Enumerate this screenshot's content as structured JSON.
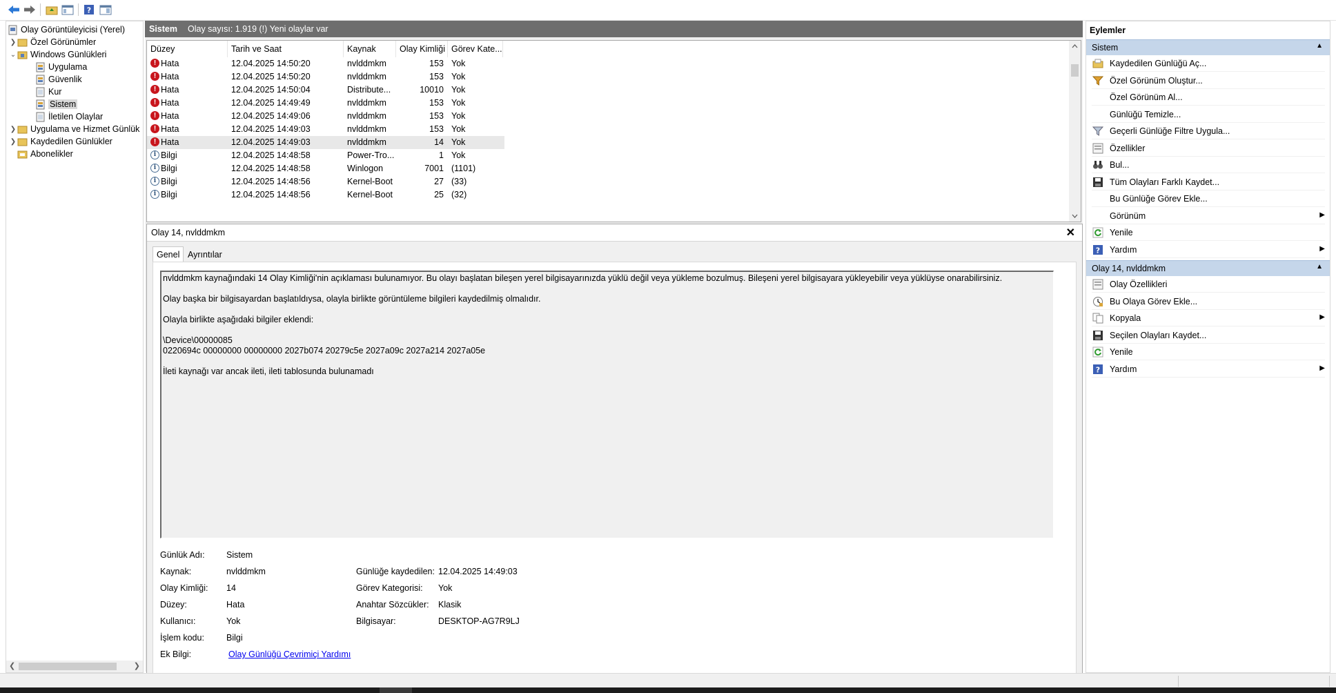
{
  "toolbar": {
    "buttons": [
      "back-icon",
      "forward-icon",
      "folder-up-icon",
      "show-hide-tree-icon",
      "help-icon",
      "action-pane-icon"
    ]
  },
  "tree": {
    "root": "Olay Görüntüleyicisi (Yerel)",
    "custom_views": "Özel Görünümler",
    "windows_logs": "Windows Günlükleri",
    "application": "Uygulama",
    "security": "Güvenlik",
    "setup": "Kur",
    "system": "Sistem",
    "forwarded": "İletilen Olaylar",
    "apps_services": "Uygulama ve Hizmet Günlük",
    "saved_logs": "Kaydedilen Günlükler",
    "subscriptions": "Abonelikler"
  },
  "log_header": {
    "name": "Sistem",
    "info": "Olay sayısı: 1.919 (!) Yeni olaylar var"
  },
  "columns": [
    "Düzey",
    "Tarih ve Saat",
    "Kaynak",
    "Olay Kimliği",
    "Görev Kate..."
  ],
  "events": [
    {
      "level": "Hata",
      "type": "error",
      "date": "12.04.2025 14:50:20",
      "source": "nvlddmkm",
      "id": "153",
      "task": "Yok"
    },
    {
      "level": "Hata",
      "type": "error",
      "date": "12.04.2025 14:50:20",
      "source": "nvlddmkm",
      "id": "153",
      "task": "Yok"
    },
    {
      "level": "Hata",
      "type": "error",
      "date": "12.04.2025 14:50:04",
      "source": "Distribute...",
      "id": "10010",
      "task": "Yok"
    },
    {
      "level": "Hata",
      "type": "error",
      "date": "12.04.2025 14:49:49",
      "source": "nvlddmkm",
      "id": "153",
      "task": "Yok"
    },
    {
      "level": "Hata",
      "type": "error",
      "date": "12.04.2025 14:49:06",
      "source": "nvlddmkm",
      "id": "153",
      "task": "Yok"
    },
    {
      "level": "Hata",
      "type": "error",
      "date": "12.04.2025 14:49:03",
      "source": "nvlddmkm",
      "id": "153",
      "task": "Yok"
    },
    {
      "level": "Hata",
      "type": "error",
      "date": "12.04.2025 14:49:03",
      "source": "nvlddmkm",
      "id": "14",
      "task": "Yok"
    },
    {
      "level": "Bilgi",
      "type": "info",
      "date": "12.04.2025 14:48:58",
      "source": "Power-Tro...",
      "id": "1",
      "task": "Yok"
    },
    {
      "level": "Bilgi",
      "type": "info",
      "date": "12.04.2025 14:48:58",
      "source": "Winlogon",
      "id": "7001",
      "task": "(1101)"
    },
    {
      "level": "Bilgi",
      "type": "info",
      "date": "12.04.2025 14:48:56",
      "source": "Kernel-Boot",
      "id": "27",
      "task": "(33)"
    },
    {
      "level": "Bilgi",
      "type": "info",
      "date": "12.04.2025 14:48:56",
      "source": "Kernel-Boot",
      "id": "25",
      "task": "(32)"
    }
  ],
  "detail": {
    "title": "Olay 14, nvlddmkm",
    "close": "✕",
    "tab_general": "Genel",
    "tab_details": "Ayrıntılar",
    "desc_lines": [
      "nvlddmkm kaynağındaki 14 Olay Kimliği'nin açıklaması bulunamıyor. Bu olayı başlatan bileşen yerel bilgisayarınızda yüklü değil veya yükleme bozulmuş. Bileşeni yerel bilgisayara yükleyebilir veya yüklüyse onarabilirsiniz.",
      "Olay başka bir bilgisayardan başlatıldıysa, olayla birlikte görüntüleme bilgileri kaydedilmiş olmalıdır.",
      "Olayla birlikte aşağıdaki bilgiler eklendi:",
      "\\Device\\00000085",
      "0220694c 00000000 00000000 2027b074 20279c5e 2027a09c 2027a214 2027a05e",
      "İleti kaynağı var ancak ileti, ileti tablosunda bulunamadı"
    ],
    "log_name_label": "Günlük Adı:",
    "log_name": "Sistem",
    "source_label": "Kaynak:",
    "source": "nvlddmkm",
    "event_id_label": "Olay Kimliği:",
    "event_id": "14",
    "level_label": "Düzey:",
    "level": "Hata",
    "user_label": "Kullanıcı:",
    "user": "Yok",
    "opcode_label": "İşlem kodu:",
    "opcode": "Bilgi",
    "more_info_label": "Ek Bilgi:",
    "more_info_link": "Olay Günlüğü Çevrimiçi Yardımı",
    "logged_label": "Günlüğe kaydedilen:",
    "logged": "12.04.2025 14:49:03",
    "task_cat_label": "Görev Kategorisi:",
    "task_cat": "Yok",
    "keywords_label": "Anahtar Sözcükler:",
    "keywords": "Klasik",
    "computer_label": "Bilgisayar:",
    "computer": "DESKTOP-AG7R9LJ"
  },
  "actions": {
    "title": "Eylemler",
    "section1": "Sistem",
    "items1": [
      {
        "label": "Kaydedilen Günlüğü Aç...",
        "icon": "open-saved-log-icon"
      },
      {
        "label": "Özel Görünüm Oluştur...",
        "icon": "filter-create-icon"
      },
      {
        "label": "Özel Görünüm Al...",
        "icon": "none"
      },
      {
        "label": "Günlüğü Temizle...",
        "icon": "none"
      },
      {
        "label": "Geçerli Günlüğe Filtre Uygula...",
        "icon": "filter-icon"
      },
      {
        "label": "Özellikler",
        "icon": "properties-icon"
      },
      {
        "label": "Bul...",
        "icon": "binoculars-icon"
      },
      {
        "label": "Tüm Olayları Farklı Kaydet...",
        "icon": "save-icon"
      },
      {
        "label": "Bu Günlüğe Görev Ekle...",
        "icon": "none"
      },
      {
        "label": "Görünüm",
        "icon": "none",
        "sub": true
      },
      {
        "label": "Yenile",
        "icon": "refresh-icon"
      },
      {
        "label": "Yardım",
        "icon": "help-icon",
        "sub": true
      }
    ],
    "section2": "Olay 14, nvlddmkm",
    "items2": [
      {
        "label": "Olay Özellikleri",
        "icon": "event-properties-icon"
      },
      {
        "label": "Bu Olaya Görev Ekle...",
        "icon": "task-icon"
      },
      {
        "label": "Kopyala",
        "icon": "copy-icon",
        "sub": true
      },
      {
        "label": "Seçilen Olayları Kaydet...",
        "icon": "save-icon"
      },
      {
        "label": "Yenile",
        "icon": "refresh-icon"
      },
      {
        "label": "Yardım",
        "icon": "help-icon",
        "sub": true
      }
    ]
  },
  "colors": {
    "accent": "#c5d6ea",
    "header_bar": "#6e6e6e",
    "error": "#c8161d",
    "link": "#0000ee"
  }
}
